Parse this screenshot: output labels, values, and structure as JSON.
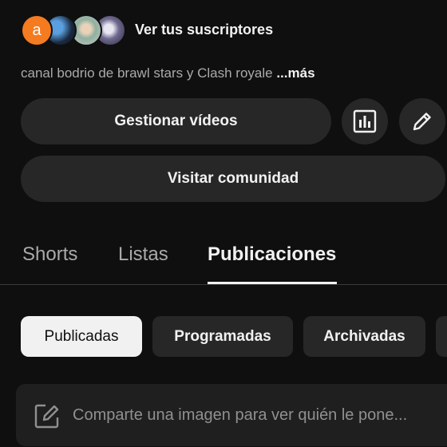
{
  "subscribers": {
    "avatar_letter": "a",
    "link_label": "Ver tus suscriptores"
  },
  "description": {
    "text": "canal bodrio de brawl stars y Clash royale ",
    "more_label": "...más"
  },
  "actions": {
    "manage_videos_label": "Gestionar vídeos",
    "stats_icon": "bar-chart-icon",
    "edit_icon": "pencil-icon",
    "visit_community_label": "Visitar comunidad"
  },
  "tabs": [
    {
      "label": "Shorts",
      "active": false
    },
    {
      "label": "Listas",
      "active": false
    },
    {
      "label": "Publicaciones",
      "active": true
    }
  ],
  "filters": [
    {
      "label": "Publicadas",
      "selected": true
    },
    {
      "label": "Programadas",
      "selected": false
    },
    {
      "label": "Archivadas",
      "selected": false
    }
  ],
  "composer": {
    "icon": "edit-square-icon",
    "placeholder": "Comparte una imagen para ver quién le pone..."
  },
  "colors": {
    "background": "#0f0f0f",
    "surface": "#272727",
    "text_primary": "#f1f1f1",
    "text_secondary": "#aaaaaa",
    "avatar_accent": "#f47b20"
  }
}
